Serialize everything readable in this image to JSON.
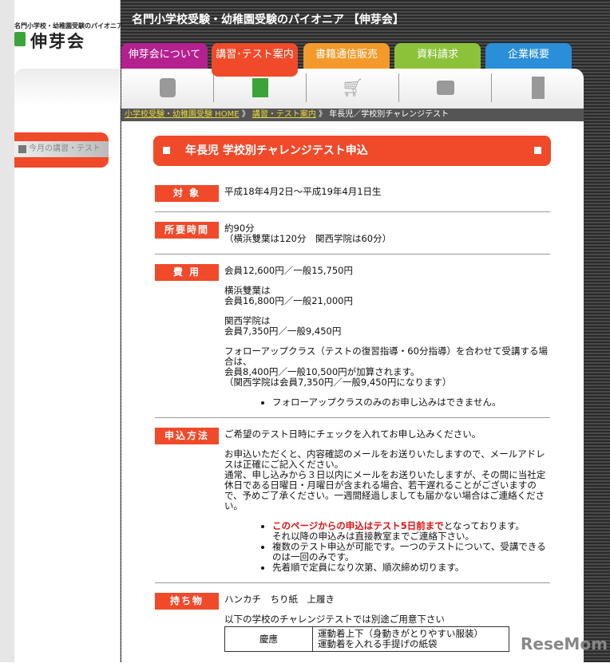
{
  "header": {
    "logo_tagline": "名門小学校・幼稚園受験のパイオニア",
    "logo_name": "伸芽会",
    "site_title": "名門小学校受験・幼稚園受験のパイオニア 【伸芽会】"
  },
  "tabs": [
    {
      "label": "伸芽会について",
      "color": "#b5208f"
    },
    {
      "label": "講習･テスト案内",
      "color": "#f04a2a"
    },
    {
      "label": "書籍通信販売",
      "color": "#f39a2a"
    },
    {
      "label": "資料請求",
      "color": "#8cc23a"
    },
    {
      "label": "企業概要",
      "color": "#2a8fd8"
    }
  ],
  "breadcrumb": {
    "home": "小学校受験・幼稚園受験 HOME",
    "sep": " 》 ",
    "parent": "講習・テスト案内",
    "current": "年長児／学校別チャレンジテスト"
  },
  "sidebar": {
    "item": "今月の講習・テスト"
  },
  "page_title": "年長児 学校別チャレンジテスト申込",
  "sections": {
    "target": {
      "label": "対 象",
      "text": "平成18年4月2日～平成19年4月1日生"
    },
    "duration": {
      "label": "所要時間",
      "l1": "約90分",
      "l2": "（横浜雙葉は120分　関西学院は60分）"
    },
    "fee": {
      "label": "費 用",
      "p1": "会員12,600円／一般15,750円",
      "p2a": "横浜雙葉は",
      "p2b": "会員16,800円／一般21,000円",
      "p3a": "関西学院は",
      "p3b": "会員7,350円／一般9,450円",
      "p4a": "フォローアップクラス（テストの復習指導・60分指導）を合わせて受講する場合は、",
      "p4b": "会員8,400円／一般10,500円が加算されます。",
      "p4c": "（関西学院は会員7,350円／一般9,450円になります）",
      "bullet": "フォローアップクラスのみのお申し込みはできません。"
    },
    "apply": {
      "label": "申込方法",
      "p1": "ご希望のテスト日時にチェックを入れてお申し込みください。",
      "p2": "お申込いただくと、内容確認のメールをお送りいたしますので、メールアドレスは正確にご記入ください。",
      "p3": "通常、申し込みから３日以内にメールをお送りいたしますが、その間に当社定休日である日曜日・月曜日が含まれる場合、若干遅れることがございますので、予めご了承ください。一週間経過しましても届かない場合はご連絡ください。",
      "b1_red": "このページからの申込はテスト5日前まで",
      "b1_rest": "となっております。",
      "b1_l2": "それ以降の申込みは直接教室までご連絡下さい。",
      "b2": "複数のテスト申込が可能です。一つのテストについて、受講できるのは一回のみです。",
      "b3": "先着順で定員になり次第、順次締め切ります。"
    },
    "items": {
      "label": "持ち物",
      "text": "ハンカチ　ちり紙　上履き",
      "note": "以下の学校のチャレンジテストでは別途ご用意下さい",
      "school": "慶應",
      "req1": "運動着上下（身動きがとりやすい服装）",
      "req2": "運動着を入れる手提げの紙袋"
    }
  },
  "watermark": "ReseMom"
}
